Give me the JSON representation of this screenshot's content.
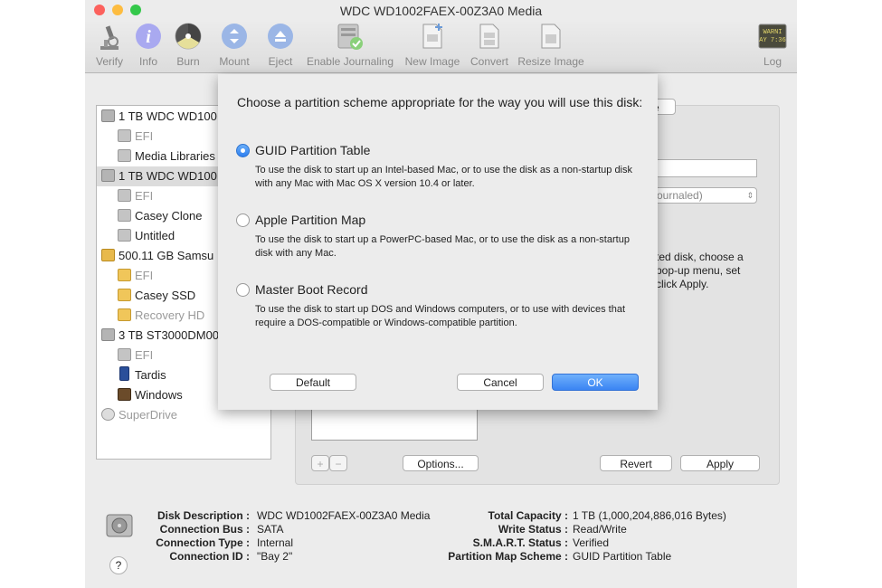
{
  "window": {
    "title": "WDC WD1002FAEX-00Z3A0 Media",
    "traffic_colors": [
      "#fc615d",
      "#fdbc40",
      "#34c84a"
    ]
  },
  "toolbar": {
    "items": [
      {
        "label": "Verify",
        "icon": "microscope-icon"
      },
      {
        "label": "Info",
        "icon": "info-icon"
      },
      {
        "label": "Burn",
        "icon": "burn-icon"
      },
      {
        "label": "Mount",
        "icon": "mount-icon"
      },
      {
        "label": "Eject",
        "icon": "eject-icon"
      },
      {
        "label": "Enable Journaling",
        "icon": "journaling-icon"
      },
      {
        "label": "New Image",
        "icon": "new-image-icon"
      },
      {
        "label": "Convert",
        "icon": "convert-icon"
      },
      {
        "label": "Resize Image",
        "icon": "resize-image-icon"
      }
    ],
    "log_label": "Log",
    "log_icon_text": "WARNI\nAY 7:36"
  },
  "sidebar": {
    "items": [
      {
        "label": "1 TB WDC WD100",
        "icon": "hard-disk-icon"
      },
      {
        "label": "EFI",
        "icon": "volume-icon"
      },
      {
        "label": "Media Libraries",
        "icon": "volume-icon"
      },
      {
        "label": "1 TB WDC WD100",
        "icon": "hard-disk-icon"
      },
      {
        "label": "EFI",
        "icon": "volume-icon"
      },
      {
        "label": "Casey Clone",
        "icon": "volume-icon"
      },
      {
        "label": "Untitled",
        "icon": "volume-icon"
      },
      {
        "label": "500.11 GB Samsu",
        "icon": "external-disk-icon"
      },
      {
        "label": "EFI",
        "icon": "external-volume-icon"
      },
      {
        "label": "Casey SSD",
        "icon": "external-volume-icon"
      },
      {
        "label": "Recovery HD",
        "icon": "external-volume-icon"
      },
      {
        "label": "3 TB ST3000DM00",
        "icon": "hard-disk-icon"
      },
      {
        "label": "EFI",
        "icon": "volume-icon"
      },
      {
        "label": "Tardis",
        "icon": "tardis-icon"
      },
      {
        "label": "Windows",
        "icon": "windows-volume-icon"
      },
      {
        "label": "SuperDrive",
        "icon": "optical-drive-icon"
      }
    ]
  },
  "right_panel": {
    "partial_button": "e",
    "format_popup_partial": "Journaled)",
    "help_text_lines": [
      "ted disk, choose a",
      "pop-up menu, set",
      "click Apply."
    ],
    "add_label": "+",
    "remove_label": "−",
    "options_label": "Options...",
    "revert_label": "Revert",
    "apply_label": "Apply"
  },
  "sheet": {
    "heading": "Choose a partition scheme appropriate for the way you will use this disk:",
    "options": [
      {
        "title": "GUID Partition Table",
        "desc": "To use the disk to start up an Intel-based Mac, or to use the disk as a non-startup disk with any Mac with Mac OS X version 10.4 or later.",
        "selected": true
      },
      {
        "title": "Apple Partition Map",
        "desc": "To use the disk to start up a PowerPC-based Mac, or to use the disk as a non-startup disk with any Mac.",
        "selected": false
      },
      {
        "title": "Master Boot Record",
        "desc": "To use the disk to start up DOS and Windows computers, or to use with devices that require a DOS-compatible or Windows-compatible partition.",
        "selected": false
      }
    ],
    "default_label": "Default",
    "cancel_label": "Cancel",
    "ok_label": "OK"
  },
  "info": {
    "left": [
      {
        "label": "Disk Description :",
        "value": "WDC WD1002FAEX-00Z3A0 Media"
      },
      {
        "label": "Connection Bus :",
        "value": "SATA"
      },
      {
        "label": "Connection Type :",
        "value": "Internal"
      },
      {
        "label": "Connection ID :",
        "value": "\"Bay 2\""
      }
    ],
    "right": [
      {
        "label": "Total Capacity :",
        "value": "1 TB (1,000,204,886,016 Bytes)"
      },
      {
        "label": "Write Status :",
        "value": "Read/Write"
      },
      {
        "label": "S.M.A.R.T. Status :",
        "value": "Verified"
      },
      {
        "label": "Partition Map Scheme :",
        "value": "GUID Partition Table"
      }
    ],
    "help_label": "?"
  }
}
